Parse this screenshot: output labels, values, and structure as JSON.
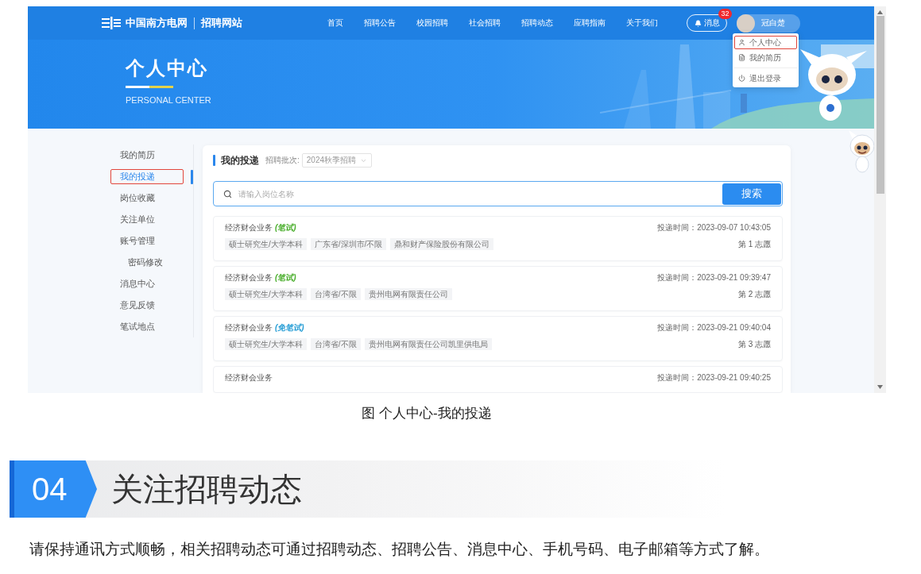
{
  "screenshot": {
    "nav": {
      "logo_text": "中国南方电网",
      "site_name": "招聘网站",
      "links": [
        "首页",
        "招聘公告",
        "校园招聘",
        "社会招聘",
        "招聘动态",
        "应聘指南",
        "关于我们"
      ],
      "messages": {
        "label": "消息",
        "badge": "32"
      },
      "user": {
        "name": "冠白楚"
      }
    },
    "user_menu": {
      "items": [
        {
          "kind": "profile",
          "label": "个人中心",
          "highlighted": true
        },
        {
          "kind": "resume",
          "label": "我的简历",
          "highlighted": false
        },
        {
          "kind": "logout",
          "label": "退出登录",
          "highlighted": false
        }
      ]
    },
    "banner": {
      "title": "个人中心",
      "subtitle": "PERSONAL CENTER"
    },
    "sidebar": {
      "items": [
        {
          "label": "我的简历",
          "selected": false,
          "highlighted": false
        },
        {
          "label": "我的投递",
          "selected": true,
          "highlighted": true
        },
        {
          "label": "岗位收藏",
          "selected": false,
          "highlighted": false
        },
        {
          "label": "关注单位",
          "selected": false,
          "highlighted": false
        },
        {
          "label": "账号管理",
          "selected": false,
          "highlighted": false,
          "children": [
            {
              "label": "密码修改",
              "selected": false,
              "highlighted": false
            }
          ]
        },
        {
          "label": "消息中心",
          "selected": false,
          "highlighted": false
        },
        {
          "label": "意见反馈",
          "selected": false,
          "highlighted": false
        },
        {
          "label": "笔试地点",
          "selected": false,
          "highlighted": false
        }
      ]
    },
    "panel": {
      "title": "我的投递",
      "batch_label": "招聘批次:",
      "batch_value": "2024秋季招聘",
      "search": {
        "placeholder": "请输入岗位名称",
        "button": "搜索"
      },
      "applications": [
        {
          "title": "经济财会业务",
          "exam": {
            "text": "(笔试)",
            "color": "#4caf2f"
          },
          "tags": [
            "硕士研究生/大学本科",
            "广东省/深圳市/不限",
            "鼎和财产保险股份有限公司"
          ],
          "time": "投递时间：2023-09-07 10:43:05",
          "rank": "第 1 志愿"
        },
        {
          "title": "经济财会业务",
          "exam": {
            "text": "(笔试)",
            "color": "#4caf2f"
          },
          "tags": [
            "硕士研究生/大学本科",
            "台湾省/不限",
            "贵州电网有限责任公司"
          ],
          "time": "投递时间：2023-09-21 09:39:47",
          "rank": "第 2 志愿"
        },
        {
          "title": "经济财会业务",
          "exam": {
            "text": "(免笔试)",
            "color": "#2a9fd6"
          },
          "tags": [
            "硕士研究生/大学本科",
            "台湾省/不限",
            "贵州电网有限责任公司凯里供电局"
          ],
          "time": "投递时间：2023-09-21 09:40:04",
          "rank": "第 3 志愿"
        },
        {
          "title": "经济财会业务",
          "time": "投递时间：2023-09-21 09:40:25"
        }
      ]
    }
  },
  "caption": "图 个人中心-我的投递",
  "section": {
    "number": "04",
    "title": "关注招聘动态"
  },
  "paragraph": "请保持通讯方式顺畅，相关招聘动态可通过招聘动态、招聘公告、消息中心、手机号码、电子邮箱等方式了解。"
}
